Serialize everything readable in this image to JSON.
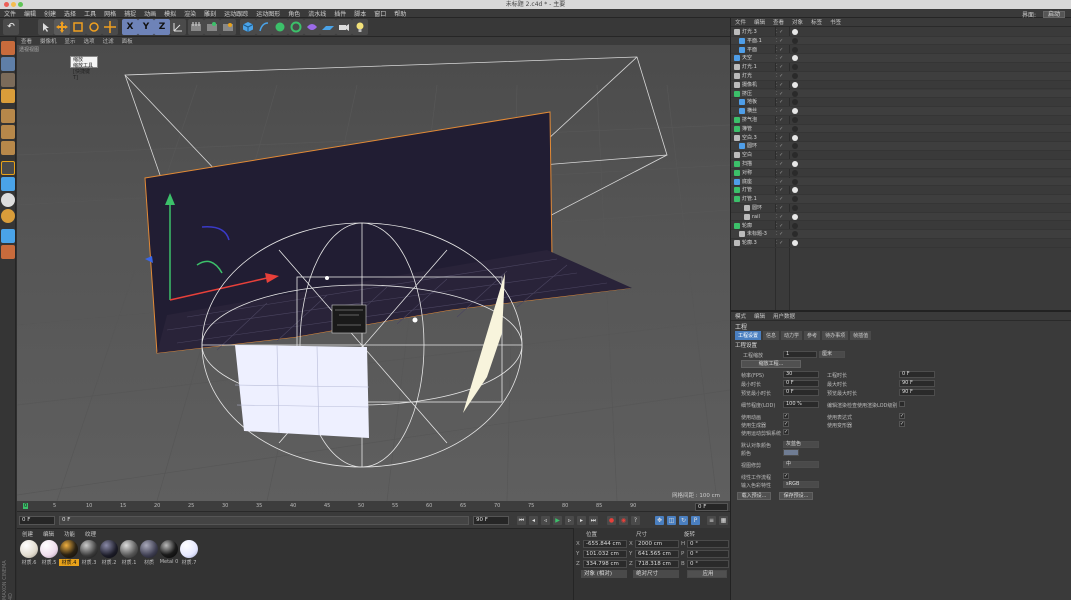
{
  "window": {
    "title": "未标题 2.c4d * - 主要"
  },
  "menubar": {
    "items": [
      "文件",
      "编辑",
      "创建",
      "选择",
      "工具",
      "网格",
      "捕捉",
      "动画",
      "模拟",
      "渲染",
      "雕刻",
      "运动跟踪",
      "运动图形",
      "角色",
      "流水线",
      "插件",
      "脚本",
      "窗口",
      "帮助"
    ],
    "layout_label": "界面:",
    "layout_value": "启动"
  },
  "toolbar": {
    "undo": "↶",
    "axis_x": "X",
    "axis_y": "Y",
    "axis_z": "Z"
  },
  "viewport": {
    "menu": [
      "查看",
      "摄像机",
      "显示",
      "选项",
      "过滤",
      "面板"
    ],
    "label": "透视视图",
    "grid_spacing": "网格间距 : 100 cm"
  },
  "tooltip": {
    "title": "缩放",
    "line1": "缩放工具",
    "line2": "[快捷键 T]"
  },
  "timeline": {
    "ticks": [
      "0",
      "5",
      "10",
      "15",
      "20",
      "25",
      "30",
      "35",
      "40",
      "45",
      "50",
      "55",
      "60",
      "65",
      "70",
      "75",
      "80",
      "85",
      "90"
    ],
    "start": "0 F",
    "current_left": "0 F",
    "end_field": "90 F",
    "end_field2": "90 F",
    "frame_right": "0 F"
  },
  "materials": {
    "menu": [
      "创建",
      "编辑",
      "功能",
      "纹理"
    ],
    "items": [
      {
        "name": "材质.6",
        "color": "#f0ede6"
      },
      {
        "name": "材质.5",
        "color": "#f3eef2"
      },
      {
        "name": "材质.4",
        "color": "#2a2214",
        "active": true
      },
      {
        "name": "材质.3",
        "color": "#3b3b3b"
      },
      {
        "name": "材质.2",
        "color": "#1c1c28"
      },
      {
        "name": "材质.1",
        "color": "#555"
      },
      {
        "name": "材质",
        "color": "#3d3d50"
      },
      {
        "name": "Metal 0",
        "color": "#1a1a1a"
      },
      {
        "name": "材质.7",
        "color": "#e6e8ff"
      }
    ]
  },
  "coords": {
    "headers": [
      "位置",
      "尺寸",
      "旋转"
    ],
    "rows": [
      {
        "axis": "X",
        "pos": "-655.844 cm",
        "size": "2000 cm",
        "rot_label": "H",
        "rot": "0 °"
      },
      {
        "axis": "Y",
        "pos": "101.032 cm",
        "size": "641.565 cm",
        "rot_label": "P",
        "rot": "0 °"
      },
      {
        "axis": "Z",
        "pos": "334.798 cm",
        "size": "718.318 cm",
        "rot_label": "B",
        "rot": "0 °"
      }
    ],
    "mode": "对象 (相对)",
    "size_mode": "绝对尺寸",
    "apply": "应用"
  },
  "objects": {
    "menu": [
      "文件",
      "编辑",
      "查看",
      "对象",
      "标签",
      "书签"
    ],
    "rows": [
      {
        "name": "灯光.3",
        "color": "#bbb",
        "indent": 0
      },
      {
        "name": "平面.1",
        "color": "#4f9ee8",
        "indent": 1
      },
      {
        "name": "平面",
        "color": "#4f9ee8",
        "indent": 1
      },
      {
        "name": "天空",
        "color": "#4f9ee8",
        "indent": 0
      },
      {
        "name": "灯光.1",
        "color": "#bbb",
        "indent": 0
      },
      {
        "name": "灯光",
        "color": "#bbb",
        "indent": 0
      },
      {
        "name": "摄像机",
        "color": "#bbb",
        "indent": 0
      },
      {
        "name": "挤压",
        "color": "#3cc06a",
        "indent": 0,
        "green": true
      },
      {
        "name": "地板",
        "color": "#4f9ee8",
        "indent": 1
      },
      {
        "name": "横丝",
        "color": "#4f9ee8",
        "indent": 1
      },
      {
        "name": "挤气泡",
        "color": "#3cc06a",
        "indent": 0
      },
      {
        "name": "簿管",
        "color": "#3cc06a",
        "indent": 0
      },
      {
        "name": "空白.3",
        "color": "#bbb",
        "indent": 0
      },
      {
        "name": "圆环",
        "color": "#4f9ee8",
        "indent": 1
      },
      {
        "name": "空白",
        "color": "#bbb",
        "indent": 0
      },
      {
        "name": "扫描",
        "color": "#3cc06a",
        "indent": 0
      },
      {
        "name": "对称",
        "color": "#3cc06a",
        "indent": 0
      },
      {
        "name": "底座",
        "color": "#4f9ee8",
        "indent": 0
      },
      {
        "name": "灯管",
        "color": "#3cc06a",
        "indent": 0
      },
      {
        "name": "灯管.1",
        "color": "#3cc06a",
        "indent": 0
      },
      {
        "name": "圆环",
        "color": "#bbb",
        "indent": 2
      },
      {
        "name": "rail",
        "color": "#bbb",
        "indent": 2
      },
      {
        "name": "轮廓",
        "color": "#3cc06a",
        "indent": 0
      },
      {
        "name": "未标题-3",
        "color": "#bbb",
        "indent": 1
      },
      {
        "name": "轮廓.3",
        "color": "#bbb",
        "indent": 0
      }
    ]
  },
  "attributes": {
    "menu": [
      "模式",
      "编辑",
      "用户数据"
    ],
    "title": "工程",
    "tabs": [
      "工程设置",
      "信息",
      "动力学",
      "参考",
      "待办事项",
      "帧插值"
    ],
    "section": "工程设置",
    "scale_label": "工程缩放",
    "scale_value": "1",
    "scale_unit": "厘米",
    "scale_button": "缩放工程...",
    "fps_label": "帧率(FPS)",
    "fps": "30",
    "project_time_label": "工程时长",
    "project_time": "0 F",
    "min_label": "最小时长",
    "min": "0 F",
    "max_label": "最大时长",
    "max": "90 F",
    "pmin_label": "预览最小时长",
    "pmin": "0 F",
    "pmax_label": "预览最大时长",
    "pmax": "90 F",
    "lod_label": "细节程度(LOD)",
    "lod": "100 %",
    "lod_render": "编辑渲染检查使用渲染LOD级别",
    "anim_label": "使用动画",
    "expr_label": "使用表达式",
    "gen_label": "使用生成器",
    "deform_label": "使用变形器",
    "motion_label": "使用运动剪辑系统",
    "default_color_label": "默认对象颜色",
    "default_color": "灰蓝色",
    "color_label": "颜色",
    "view_clip_label": "视图修剪",
    "view_clip": "中",
    "linear_label": "线性工作流程",
    "input_profile_label": "输入色彩特性",
    "input_profile": "sRGB",
    "load_preset": "载入预设...",
    "save_preset": "保存预设..."
  },
  "brand": "MAXON CINEMA 4D"
}
